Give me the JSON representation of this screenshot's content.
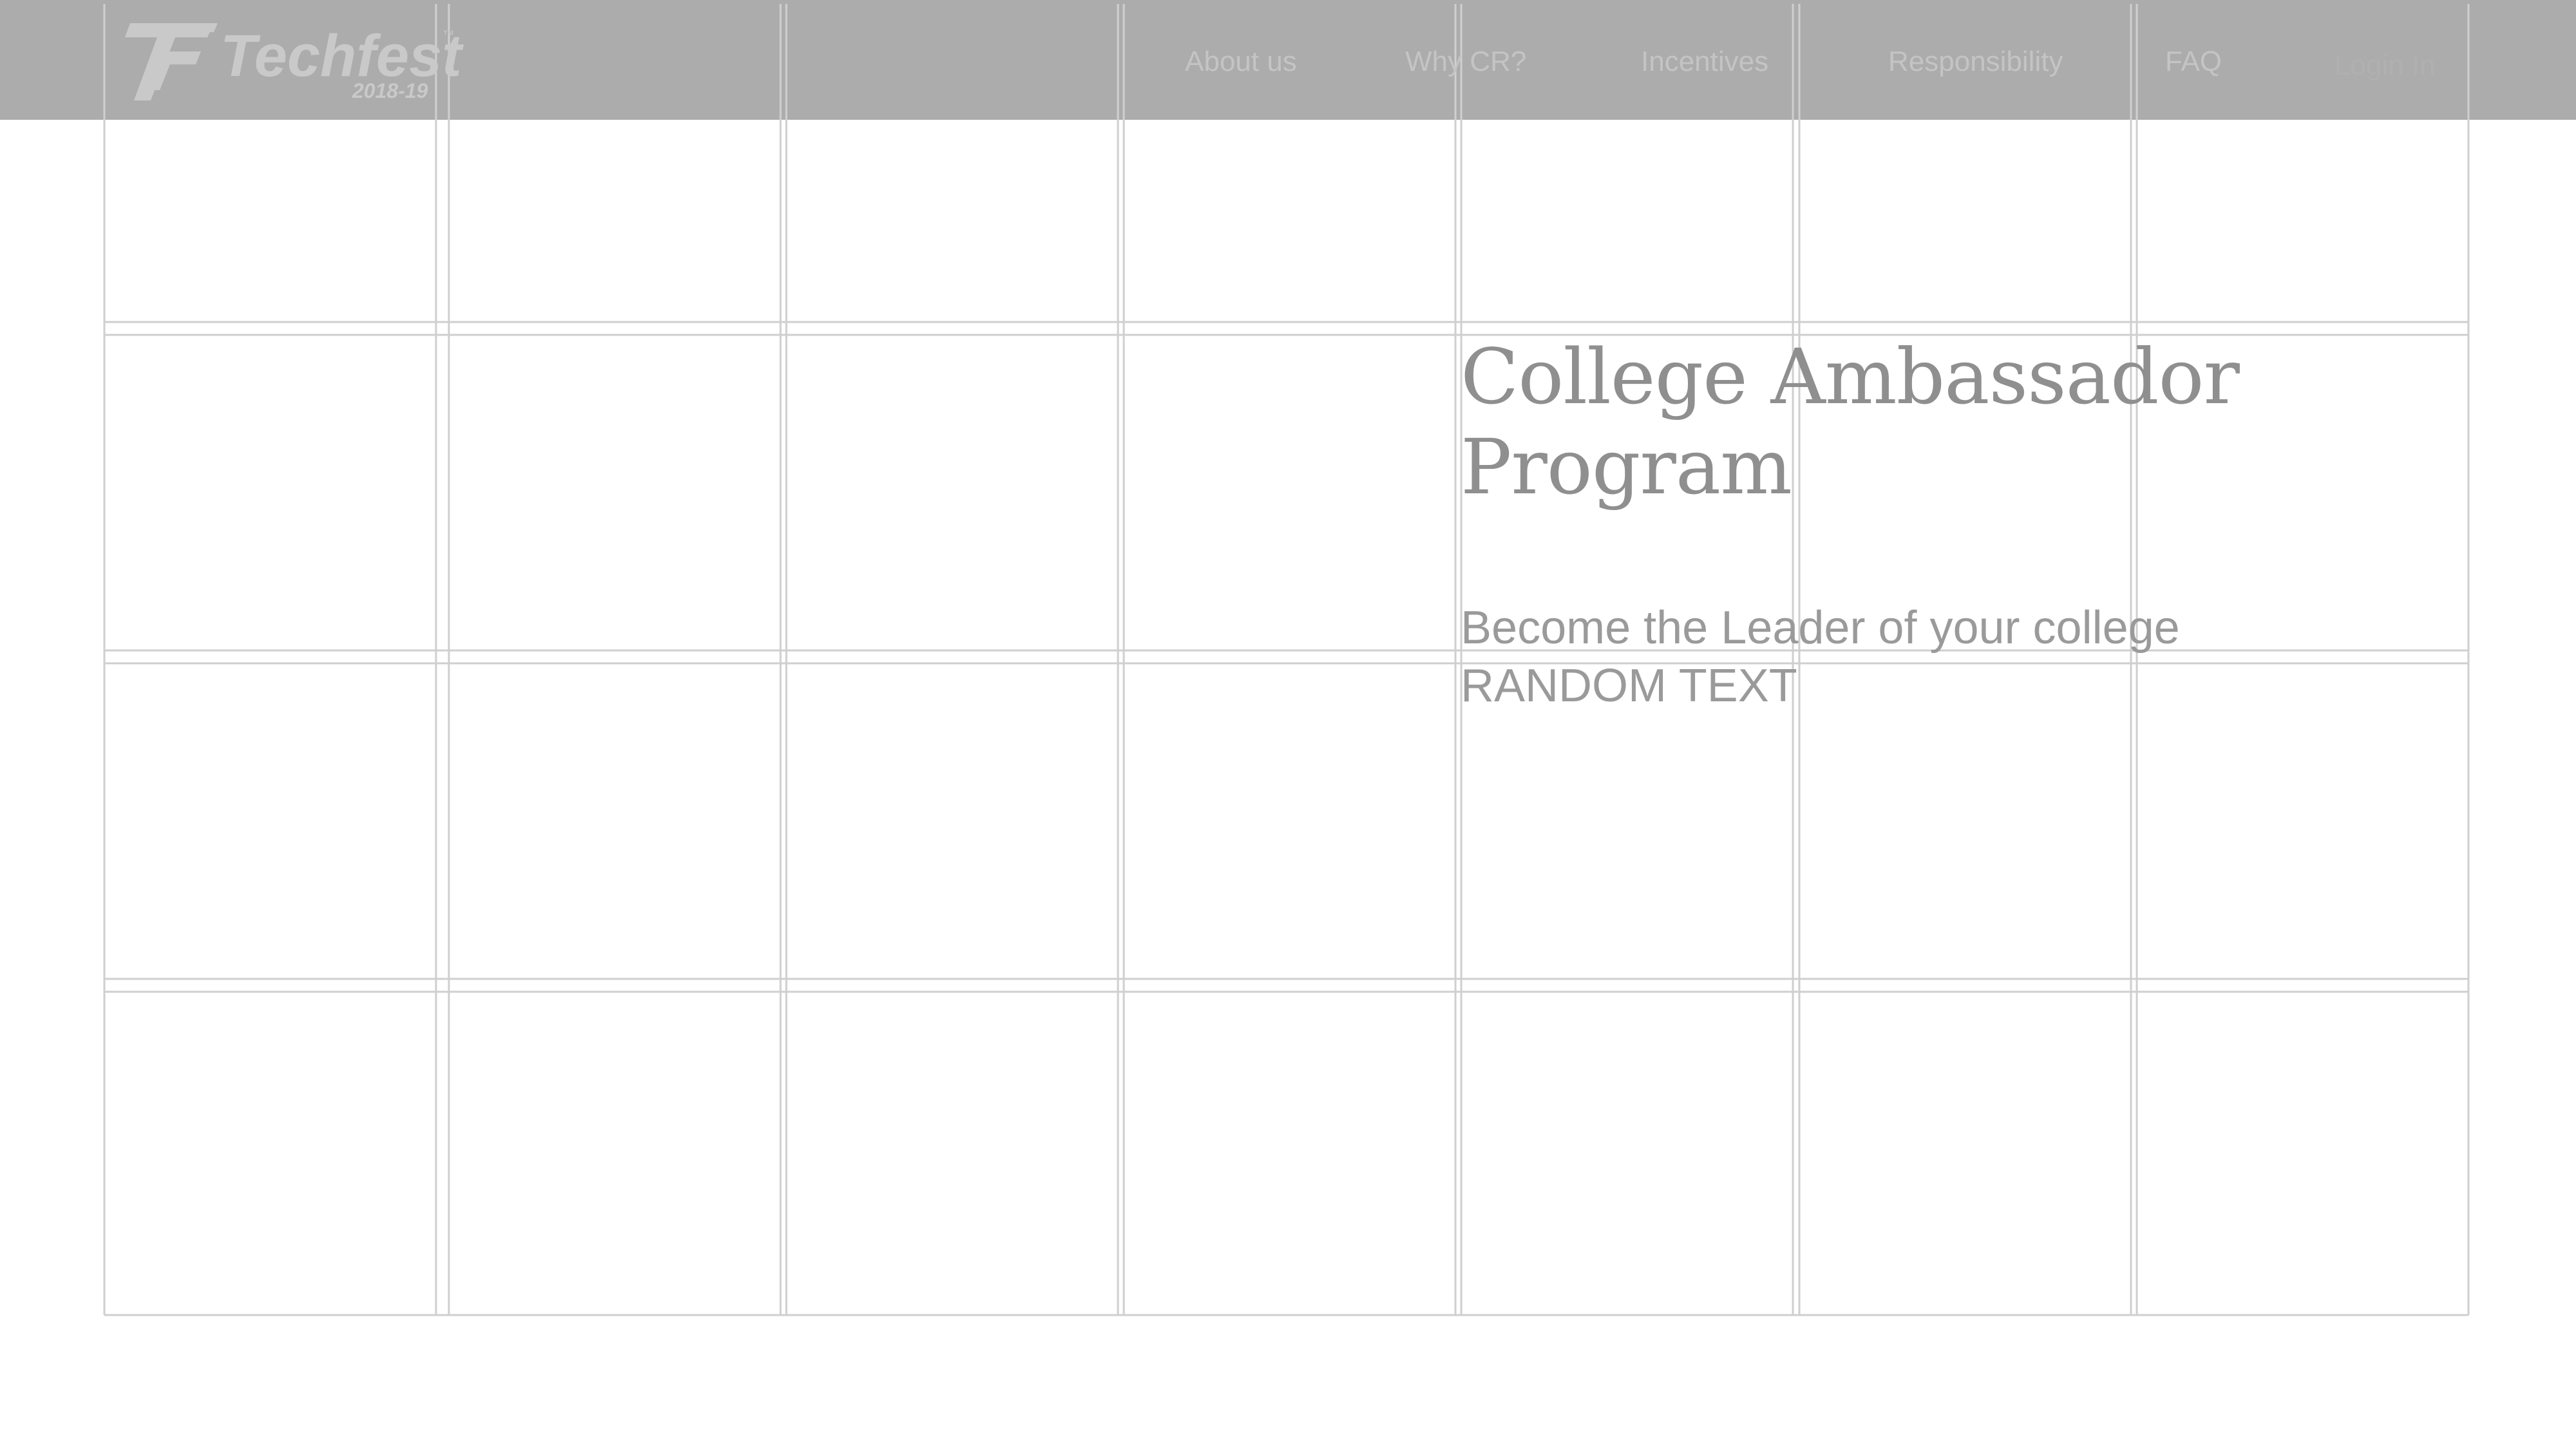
{
  "brand": {
    "name": "Techfest",
    "years": "2018-19",
    "trademark": "™"
  },
  "nav": {
    "links": [
      "About us",
      "Why CR?",
      "Incentives",
      "Responsibility",
      "FAQ"
    ],
    "login": "Login In"
  },
  "hero": {
    "title_line1": "College Ambassador",
    "title_line2": "Program",
    "subtitle": "Become the Leader of your college",
    "placeholder": "RANDOM TEXT"
  },
  "colors": {
    "navbar_bg": "#acacac",
    "grid_line": "#d0d0d0",
    "title_text": "#8f8f8f",
    "nav_text": "#c4c4c4"
  }
}
